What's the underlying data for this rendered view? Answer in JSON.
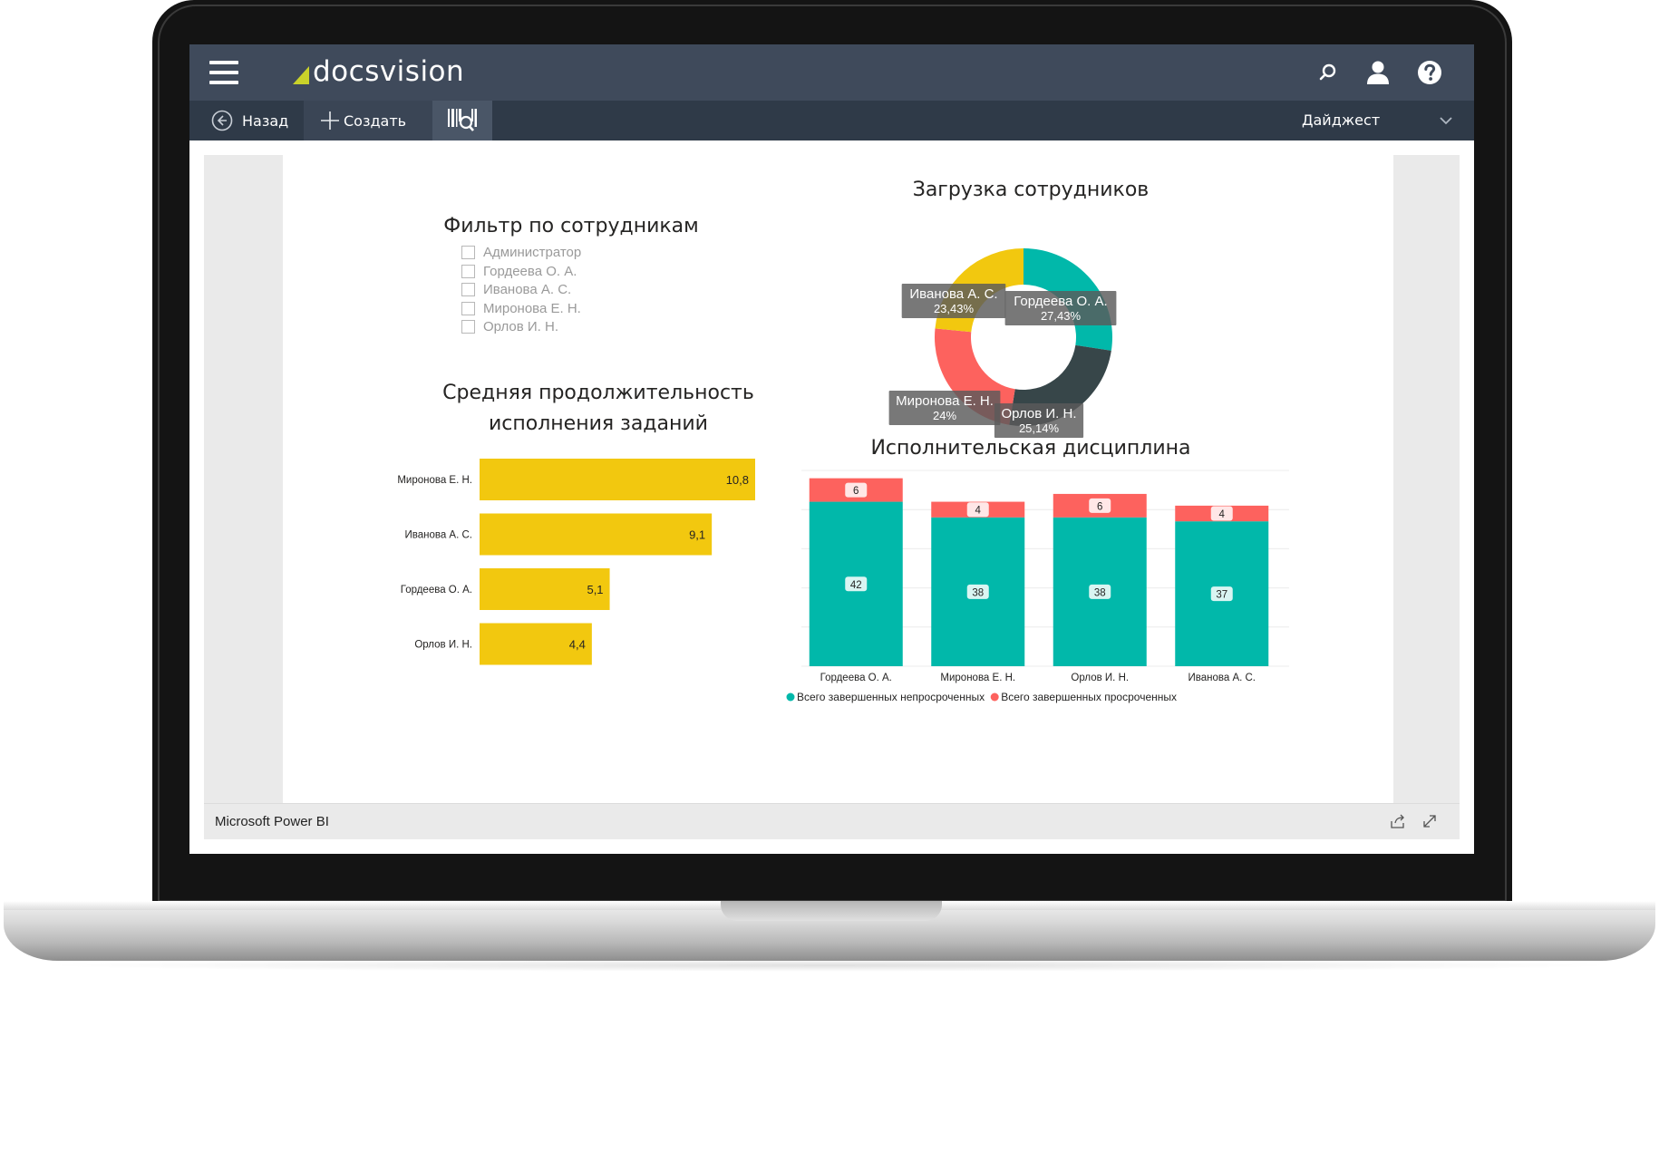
{
  "app": {
    "logo_text": "docsvision",
    "brand_color": "#c9d22a",
    "topbar_color": "#3f4a5b"
  },
  "toolbar": {
    "back_label": "Назад",
    "create_label": "Создать",
    "view_label": "Дайджест"
  },
  "icons": {
    "menu": "hamburger-icon",
    "back": "arrow-left-circle-icon",
    "create": "plus-icon",
    "scan": "barcode-search-icon",
    "search": "search-icon",
    "user": "user-icon",
    "help": "help-icon",
    "share": "share-icon",
    "fullscreen": "expand-icon"
  },
  "report": {
    "filter_title": "Фильтр по сотрудникам",
    "filter_items": [
      "Администратор",
      "Гордеева О. А.",
      "Иванова А. С.",
      "Миронова Е. Н.",
      "Орлов И. Н."
    ],
    "footer_label": "Microsoft Power BI"
  },
  "chart_data": [
    {
      "type": "pie",
      "title": "Загрузка сотрудников",
      "labels": [
        "Гордеева О. А.",
        "Орлов И. Н.",
        "Миронова Е. Н.",
        "Иванова А. С."
      ],
      "values": [
        27.43,
        25.14,
        24,
        23.43
      ],
      "value_labels": [
        "27,43%",
        "25,14%",
        "24%",
        "23,43%"
      ],
      "colors": [
        "#01b8aa",
        "#374649",
        "#fd625e",
        "#f2c80f"
      ]
    },
    {
      "type": "bar",
      "orientation": "horizontal",
      "title": "Средняя продолжительность исполнения заданий",
      "categories": [
        "Миронова Е. Н.",
        "Иванова А. С.",
        "Гордеева О. А.",
        "Орлов И. Н."
      ],
      "values": [
        10.8,
        9.1,
        5.1,
        4.4
      ],
      "value_labels": [
        "10,8",
        "9,1",
        "5,1",
        "4,4"
      ],
      "color": "#f2c80f",
      "xlim": [
        0,
        10.8
      ]
    },
    {
      "type": "bar",
      "stacked": true,
      "title": "Исполнительская дисциплина",
      "categories": [
        "Гордеева О. А.",
        "Миронова Е. Н.",
        "Орлов И. Н.",
        "Иванова А. С."
      ],
      "series": [
        {
          "name": "Всего завершенных непросроченных",
          "values": [
            42,
            38,
            38,
            37
          ],
          "color": "#01b8aa"
        },
        {
          "name": "Всего завершенных просроченных",
          "values": [
            6,
            4,
            6,
            4
          ],
          "color": "#fd625e"
        }
      ],
      "ylim": [
        0,
        50
      ],
      "grid": true,
      "legend": "bottom"
    }
  ]
}
